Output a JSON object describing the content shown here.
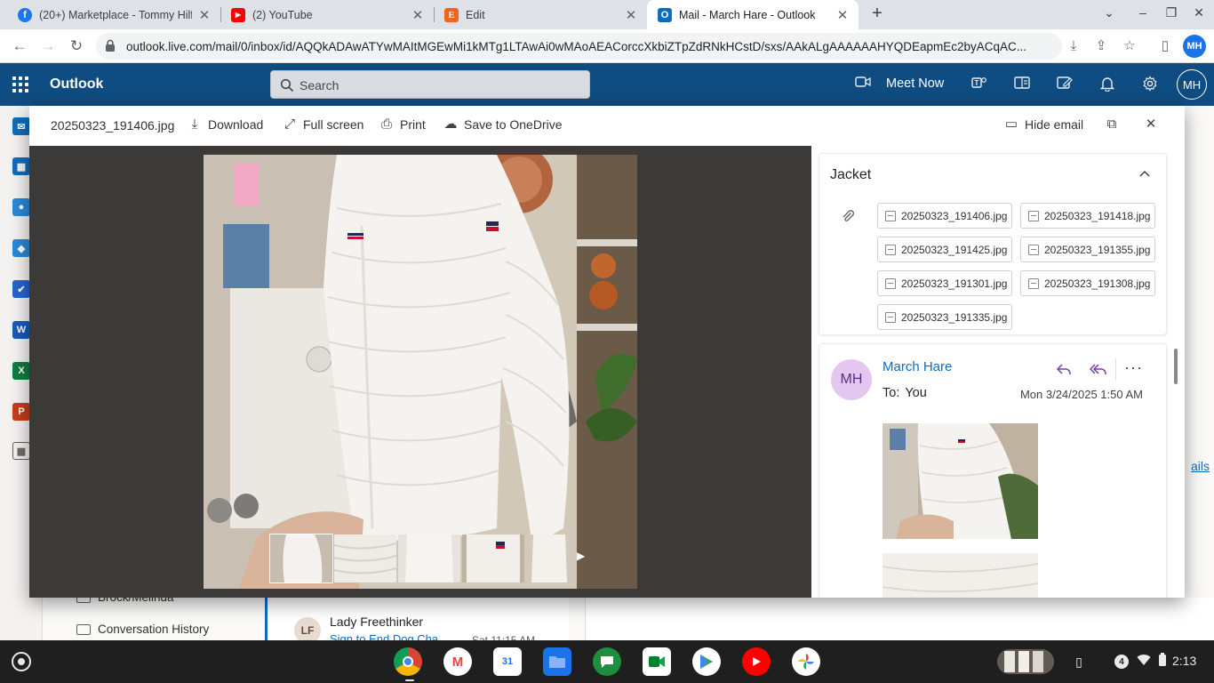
{
  "browser": {
    "tabs": [
      {
        "title": "(20+) Marketplace - Tommy Hilfi",
        "favicon": "facebook-icon",
        "color": "#1877f2"
      },
      {
        "title": "(2) YouTube",
        "favicon": "youtube-icon",
        "color": "#ff0000"
      },
      {
        "title": "Edit",
        "favicon": "etsy-icon",
        "color": "#f1641e"
      },
      {
        "title": "Mail - March Hare - Outlook",
        "favicon": "outlook-icon",
        "color": "#0f6cbd",
        "active": true
      }
    ],
    "url": "outlook.live.com/mail/0/inbox/id/AQQkADAwATYwMAItMGEwMi1kMTg1LTAwAi0wMAoAEACorccXkbiZTpZdRNkHCstD/sxs/AAkALgAAAAAAHYQDEapmEc2byACqAC...",
    "profile_initials": "MH"
  },
  "outlook": {
    "brand": "Outlook",
    "search_placeholder": "Search",
    "meet_now": "Meet Now",
    "avatar_initials": "MH",
    "accent": "#0f4c81"
  },
  "background": {
    "folders": [
      "Brock/Melinda",
      "Conversation History"
    ],
    "message": {
      "initials": "LF",
      "from": "Lady Freethinker",
      "subject": "Sign to End Dog Cha...",
      "time": "Sat 11:15 AM"
    },
    "peek_text": "ails"
  },
  "viewer": {
    "filename": "20250323_191406.jpg",
    "actions": {
      "download": "Download",
      "full_screen": "Full screen",
      "print": "Print",
      "save_onedrive": "Save to OneDrive",
      "hide_email": "Hide email"
    }
  },
  "email": {
    "subject": "Jacket",
    "attachments": [
      "20250323_191406.jpg",
      "20250323_191418.jpg",
      "20250323_191425.jpg",
      "20250323_191355.jpg",
      "20250323_191301.jpg",
      "20250323_191308.jpg",
      "20250323_191335.jpg"
    ],
    "sender_initials": "MH",
    "sender_name": "March Hare",
    "to_label": "To:",
    "to_value": "You",
    "date": "Mon 3/24/2025 1:50 AM"
  },
  "shelf": {
    "apps": [
      "chrome-icon",
      "gmail-icon",
      "calendar-icon",
      "files-icon",
      "chat-icon",
      "meet-icon",
      "play-store-icon",
      "youtube-icon",
      "photos-icon"
    ],
    "calendar_day": "31",
    "notification_count": "4",
    "time": "2:13"
  }
}
